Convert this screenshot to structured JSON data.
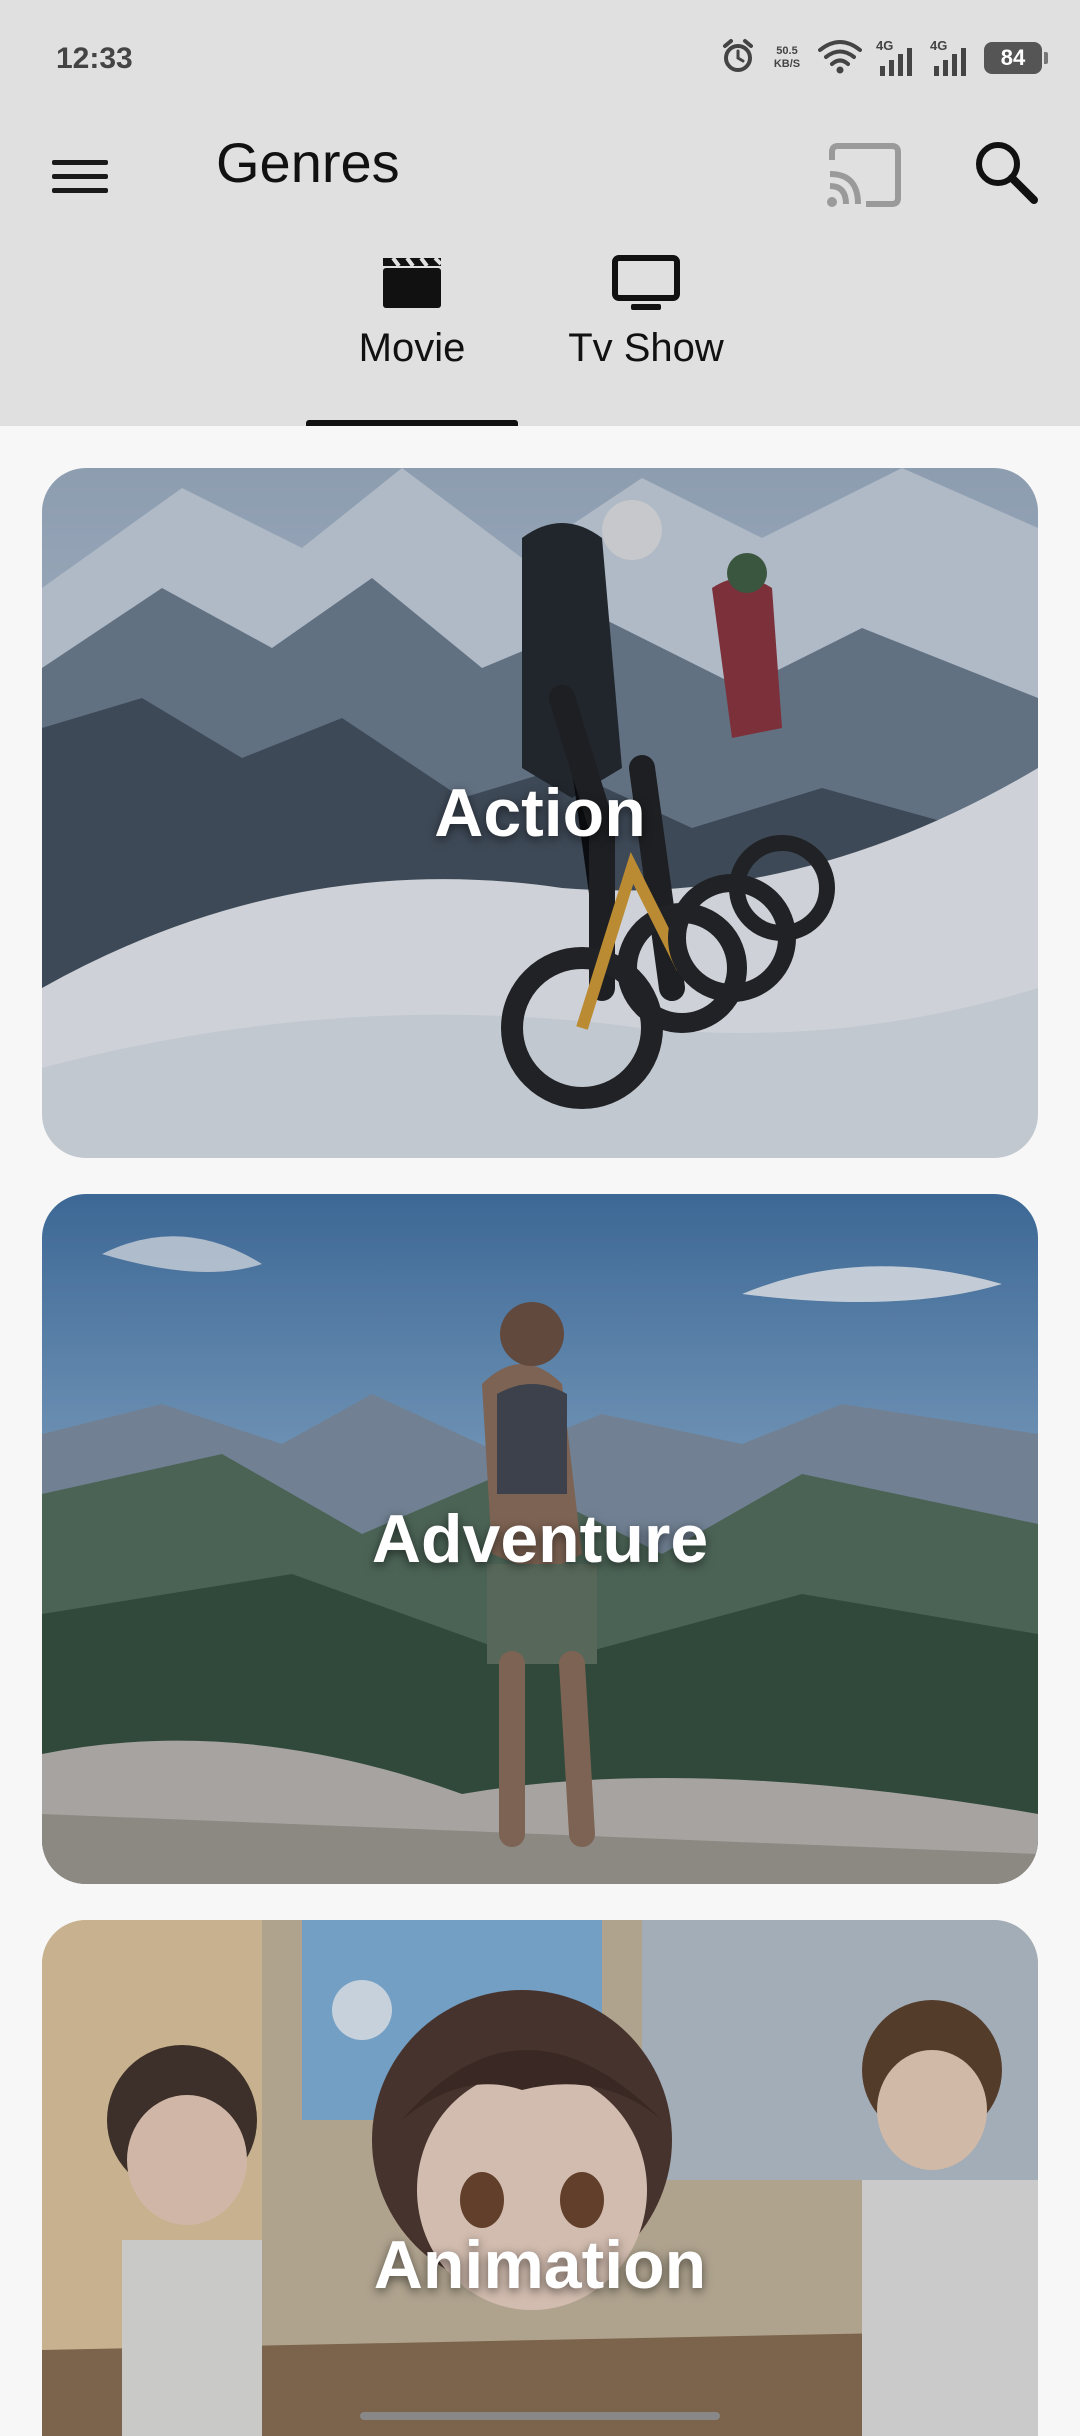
{
  "status_bar": {
    "time": "12:33",
    "net_speed_value": "50.5",
    "net_speed_unit": "KB/S",
    "signal_1": "4G",
    "signal_2": "4G",
    "battery": "84",
    "icons": [
      "alarm-icon",
      "wifi-icon",
      "signal-icon",
      "signal-icon",
      "battery-icon"
    ]
  },
  "app_bar": {
    "title": "Genres",
    "menu_icon": "menu-icon",
    "cast_icon": "cast-icon",
    "search_icon": "search-icon"
  },
  "tabs": [
    {
      "label": "Movie",
      "icon": "movie-clapper-icon",
      "selected": true
    },
    {
      "label": "Tv Show",
      "icon": "tv-icon",
      "selected": false
    }
  ],
  "genres": [
    {
      "label": "Action",
      "image": "snowy mountain bikers"
    },
    {
      "label": "Adventure",
      "image": "hiker on mountain ridge"
    },
    {
      "label": "Animation",
      "image": "anime classroom students"
    }
  ],
  "colors": {
    "app_bar_bg": "#e0e0e0",
    "content_bg": "#f7f7f7",
    "text_primary": "#111111",
    "tab_indicator": "#111111"
  }
}
